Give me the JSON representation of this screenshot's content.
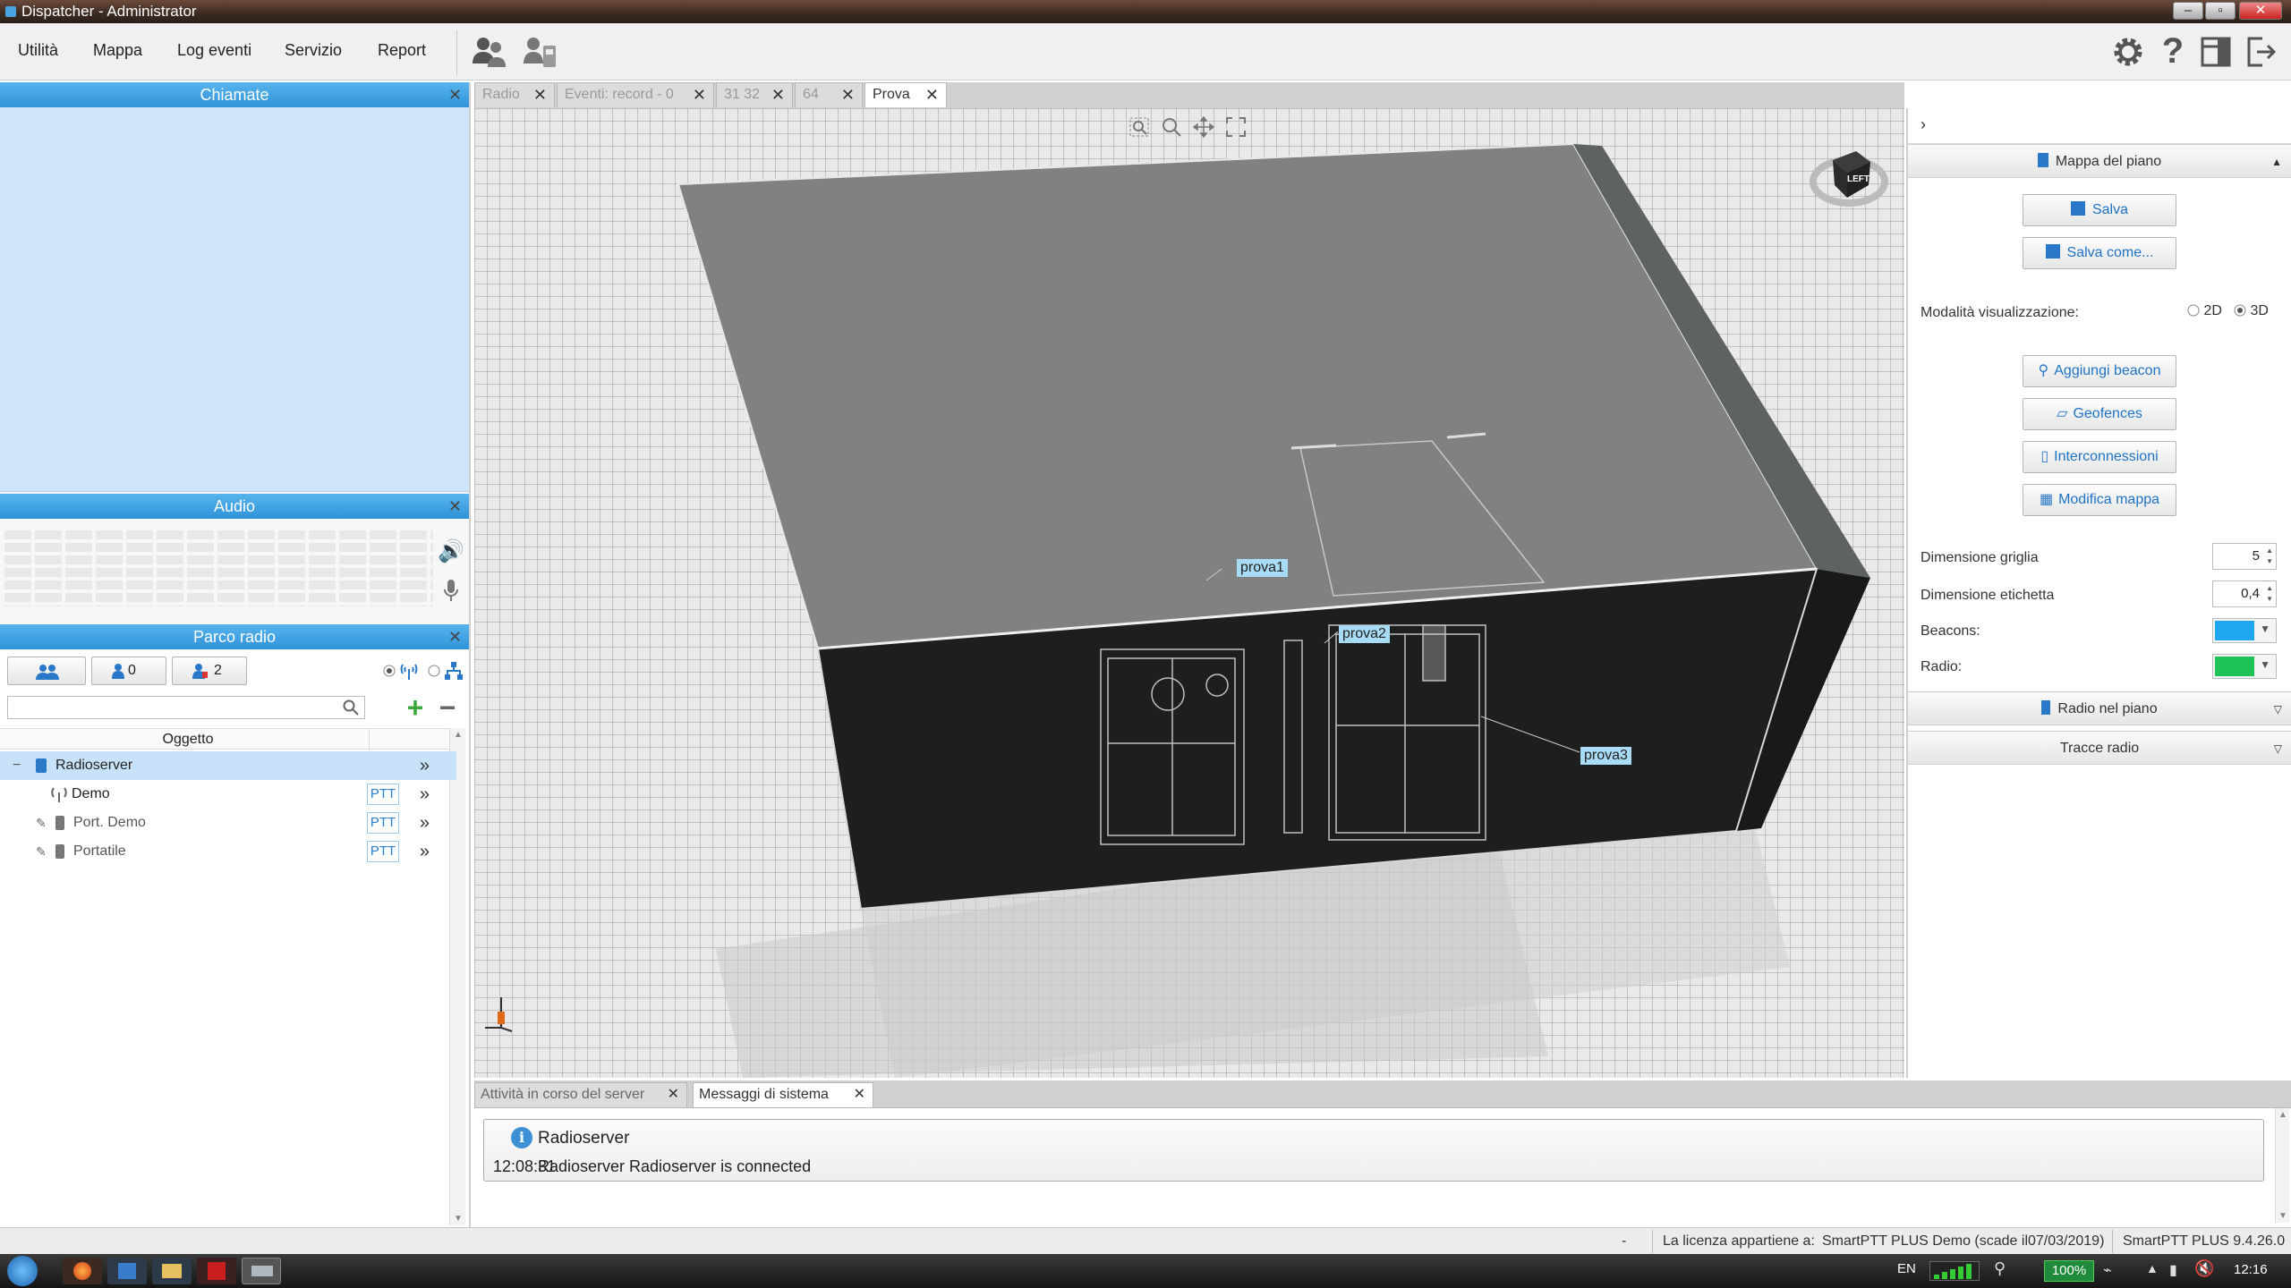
{
  "window": {
    "title": "Dispatcher - Administrator"
  },
  "menu": [
    "Utilità",
    "Mappa",
    "Log eventi",
    "Servizio",
    "Report"
  ],
  "panels": {
    "calls": {
      "title": "Chiamate"
    },
    "audio": {
      "title": "Audio"
    },
    "fleet": {
      "title": "Parco radio",
      "filter_users_count": "0",
      "filter_groups_count": "2",
      "column_header": "Oggetto",
      "tree": [
        {
          "label": "Radioserver",
          "ptt": ""
        },
        {
          "label": "Demo",
          "ptt": "PTT"
        },
        {
          "label": "Port. Demo",
          "ptt": "PTT"
        },
        {
          "label": "Portatile",
          "ptt": "PTT"
        }
      ]
    }
  },
  "tabs": [
    "Radio",
    "Eventi: record - 0",
    "31 32",
    "64",
    "Prova"
  ],
  "viewport": {
    "labels": [
      "prova1",
      "prova2",
      "prova3"
    ],
    "compass_label": "LEFT"
  },
  "right_panel": {
    "section_title": "Mappa del piano",
    "save_label": "Salva",
    "save_as_label": "Salva come...",
    "view_mode_label": "Modalità visualizzazione:",
    "mode_2d": "2D",
    "mode_3d": "3D",
    "add_beacon": "Aggiungi beacon",
    "geofences": "Geofences",
    "interconnections": "Interconnessioni",
    "edit_map": "Modifica mappa",
    "grid_size_label": "Dimensione griglia",
    "grid_size_value": "5",
    "label_size_label": "Dimensione etichetta",
    "label_size_value": "0,4",
    "beacons_label": "Beacons:",
    "radio_label": "Radio:",
    "beacons_color": "#1ea6ef",
    "radio_color": "#1fc257",
    "radios_in_plan": "Radio nel piano",
    "radio_tracks": "Tracce radio"
  },
  "bottom": {
    "tabs": [
      "Attività in corso del server",
      "Messaggi di sistema"
    ],
    "message": {
      "source": "Radioserver",
      "time": "12:08:31",
      "text": "Radioserver Radioserver is connected"
    }
  },
  "status": {
    "dash": "-",
    "license_label": "La licenza appartiene a:",
    "license_value": "SmartPTT PLUS Demo (scade il07/03/2019)",
    "version": "SmartPTT PLUS 9.4.26.0"
  },
  "taskbar": {
    "lang": "EN",
    "battery": "100%",
    "clock": "12:16"
  }
}
